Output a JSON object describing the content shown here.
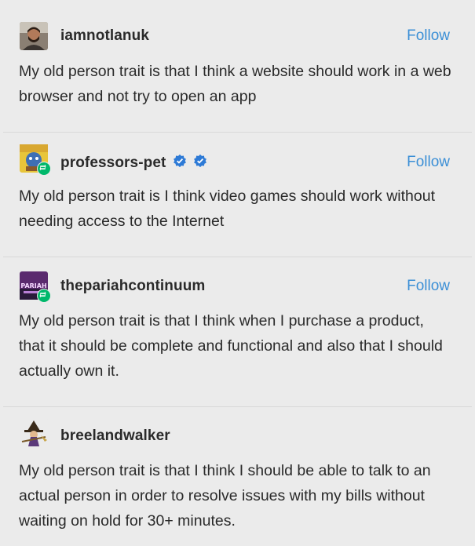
{
  "posts": [
    {
      "username": "iamnotlanuk",
      "follow_label": "Follow",
      "text": "My old person trait is that I think a website should work in a web browser and not try to open an app"
    },
    {
      "username": "professors-pet",
      "follow_label": "Follow",
      "text": "My old person trait is I think video games should work without needing access to the Internet"
    },
    {
      "username": "thepariahcontinuum",
      "follow_label": "Follow",
      "avatar_text": "PARIAH",
      "text": "My old person trait is that I think when I purchase a product, that it should be complete and functional and also that I should actually own it."
    },
    {
      "username": "breelandwalker",
      "text": "My old person trait is that I think I should be able to talk to an actual person in order to resolve issues with my bills without waiting on hold for 30+ minutes."
    }
  ],
  "colors": {
    "background": "#ebebeb",
    "follow_link": "#3b8fd6",
    "verified_badge": "#2d7ad6",
    "reblog_badge": "#00b86b"
  }
}
